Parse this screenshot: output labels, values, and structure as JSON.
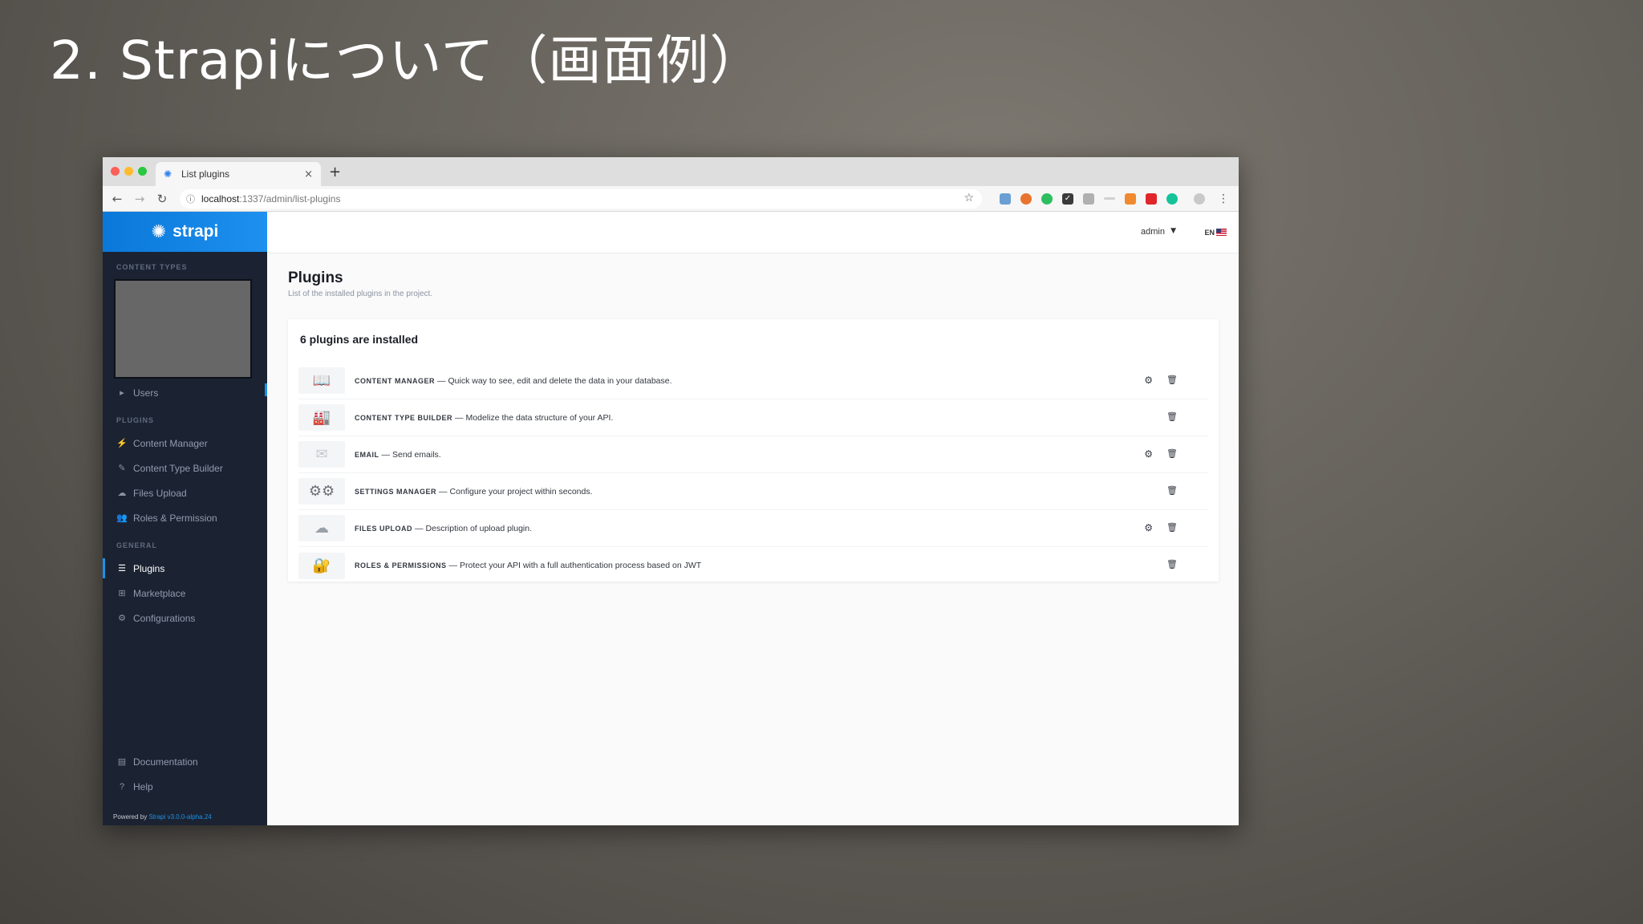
{
  "slide": {
    "title": "2. Strapiについて（画面例）"
  },
  "browser": {
    "tab_title": "List plugins",
    "tab_close": "×",
    "new_tab": "+",
    "url_host": "localhost",
    "url_path": ":1337/admin/list-plugins"
  },
  "sidebar": {
    "logo_text": "strapi",
    "content_types_heading": "CONTENT TYPES",
    "users_label": "Users",
    "plugins_heading": "PLUGINS",
    "plugins": [
      {
        "label": "Content Manager",
        "icon": "plug-icon"
      },
      {
        "label": "Content Type Builder",
        "icon": "brush-icon"
      },
      {
        "label": "Files Upload",
        "icon": "cloud-upload-icon"
      },
      {
        "label": "Roles & Permission",
        "icon": "users-icon"
      }
    ],
    "general_heading": "GENERAL",
    "general": [
      {
        "label": "Plugins",
        "icon": "list-icon",
        "active": true
      },
      {
        "label": "Marketplace",
        "icon": "basket-icon",
        "active": false
      },
      {
        "label": "Configurations",
        "icon": "gear-icon",
        "active": false
      }
    ],
    "footer": [
      {
        "label": "Documentation",
        "icon": "book-icon"
      },
      {
        "label": "Help",
        "icon": "question-icon"
      }
    ],
    "powered_by": "Powered by ",
    "powered_version": "Strapi v3.0.0-alpha.24"
  },
  "header": {
    "user": "admin",
    "language": "EN"
  },
  "main": {
    "title": "Plugins",
    "subtitle": "List of the installed plugins in the project.",
    "card_title": "6 plugins are installed",
    "separator": "—",
    "plugins": [
      {
        "name": "CONTENT MANAGER",
        "description": "Quick way to see, edit and delete the data in your database.",
        "icon": "book-icon",
        "settings": true
      },
      {
        "name": "CONTENT TYPE BUILDER",
        "description": "Modelize the data structure of your API.",
        "icon": "factory-icon",
        "settings": false
      },
      {
        "name": "EMAIL",
        "description": "Send emails.",
        "icon": "envelope-icon",
        "settings": true
      },
      {
        "name": "SETTINGS MANAGER",
        "description": "Configure your project within seconds.",
        "icon": "gears-icon",
        "settings": false
      },
      {
        "name": "FILES UPLOAD",
        "description": "Description of upload plugin.",
        "icon": "cloud-upload-icon",
        "settings": true
      },
      {
        "name": "ROLES & PERMISSIONS",
        "description": "Protect your API with a full authentication process based on JWT",
        "icon": "lock-icon",
        "settings": false
      }
    ]
  }
}
